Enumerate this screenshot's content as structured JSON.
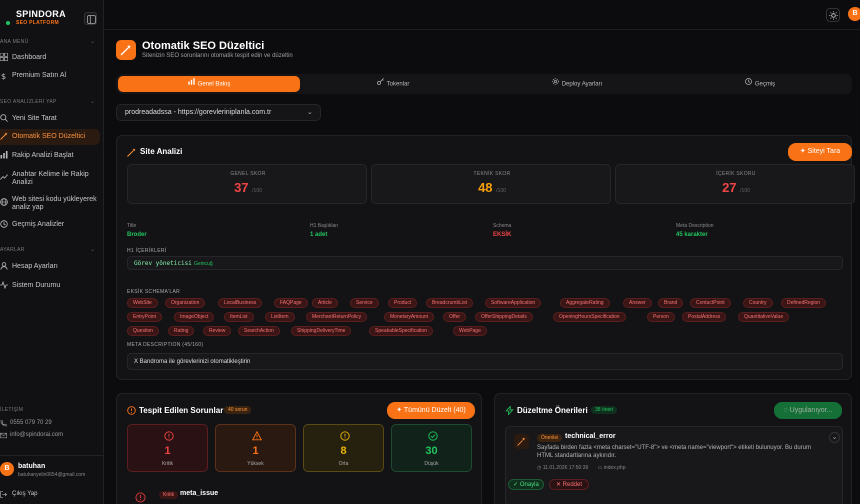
{
  "brand": {
    "name": "SPINDORA",
    "sub": "SEO PLATFORM"
  },
  "sidebar": {
    "section1": "ANA MENÜ",
    "items1": [
      "Dashboard",
      "Premium Satın Al"
    ],
    "section2": "SEO ANALİZLERİ YAP",
    "items2": [
      "Yeni Site Tarat",
      "Otomatik SEO Düzeltici",
      "Rakip Analizi Başlat",
      "Anahtar Kelime ile Rakip Analizi",
      "Web sitesi kodu yükleyerek analiz yap",
      "Geçmiş Analizler"
    ],
    "section3": "AYARLAR",
    "items3": [
      "Hesap Ayarları",
      "Sistem Durumu"
    ],
    "contact_title": "İLETİŞİM",
    "phone": "0555 079 70 29",
    "email": "info@spindorai.com",
    "user_name": "batuhan",
    "user_email": "batuhanyelin0654@gmail.com",
    "user_initial": "B",
    "logout": "Çıkış Yap"
  },
  "top": {
    "avatar_initial": "B"
  },
  "page": {
    "title": "Otomatik SEO Düzeltici",
    "subtitle": "Sitenizin SEO sorunlarını otomatik tespit edin ve düzeltin"
  },
  "tabs": [
    "Genel Bakış",
    "Tokenlar",
    "Deploy Ayarları",
    "Geçmiş"
  ],
  "site_select": {
    "value": "prodreadadssa - https://gorevleriniplanla.com.tr"
  },
  "analysis": {
    "title": "Site Analizi",
    "scan_button": "Siteyi Tara",
    "scores": [
      {
        "label": "GENEL SKOR",
        "value": "37",
        "max": "/100",
        "color": "#ef4444"
      },
      {
        "label": "TEKNİK SKOR",
        "value": "48",
        "max": "/100",
        "color": "#f59e0b"
      },
      {
        "label": "İÇERİK SKORU",
        "value": "27",
        "max": "/100",
        "color": "#ef4444"
      }
    ],
    "meta": [
      {
        "label": "Title",
        "value": "Broder",
        "color": "#22c55e"
      },
      {
        "label": "H1 Başlıkları",
        "value": "1 adet",
        "color": "#22c55e"
      },
      {
        "label": "Schema",
        "value": "EKSİK",
        "color": "#ef4444"
      },
      {
        "label": "Meta Description",
        "value": "45 karakter",
        "color": "#22c55e"
      }
    ],
    "h1_title": "H1 İÇERİKLERİ",
    "h1_value": "Görev yöneticisi",
    "h1_badge": "Geincuğ",
    "schema_title": "EKSİK SCHEMA'LAR",
    "schemas": [
      "WebSite",
      "Organization",
      "LocalBusiness",
      "FAQPage",
      "Article",
      "Service",
      "Product",
      "BreadcrumbList",
      "SoftwareApplication",
      "AggregateRating",
      "Answer",
      "Brand",
      "ContactPoint",
      "Country",
      "DefinedRegion",
      "EntryPoint",
      "ImageObject",
      "ItemList",
      "ListItem",
      "MerchantReturnPolicy",
      "MonetaryAmount",
      "Offer",
      "OfferShippingDetails",
      "OpeningHoursSpecification",
      "Person",
      "PostalAddress",
      "QuantitativeValue",
      "Question",
      "Rating",
      "Review",
      "SearchAction",
      "ShippingDeliveryTime",
      "SpeakableSpecification",
      "WebPage"
    ],
    "desc_title": "META DESCRIPTION (45/160)",
    "desc_value": "X Bandroma ile görevlerinizi otomatikleştirin"
  },
  "issues": {
    "title": "Tespit Edilen Sorunlar",
    "count_badge": "40 sorun",
    "fix_all": "Tümünü Düzelt (40)",
    "stats": [
      {
        "n": "1",
        "label": "Kritik",
        "color": "#ef4444",
        "bg": "#2a1214",
        "border": "#5c1e22"
      },
      {
        "n": "1",
        "label": "Yüksek",
        "color": "#f97316",
        "bg": "#2a1910",
        "border": "#5c331a"
      },
      {
        "n": "8",
        "label": "Orta",
        "color": "#eab308",
        "bg": "#26210f",
        "border": "#5a4a16"
      },
      {
        "n": "30",
        "label": "Düşük",
        "color": "#22c55e",
        "bg": "#10221a",
        "border": "#1d4a30"
      }
    ],
    "first_tag": "Kritik",
    "first_name": "meta_issue"
  },
  "fixes": {
    "title": "Düzeltme Önerileri",
    "count_badge": "38 öneri",
    "applying": "Uygulanıyor...",
    "item_tag": "Önerilei",
    "item_title": "technical_error",
    "item_desc": "Sayfada birden fazla <meta charset=\"UTF-8\"> ve <meta name=\"viewport\"> etiketi bulunuyor. Bu durum HTML standartlarına aykırıdır.",
    "item_date": "11.01.2026 17:50:39",
    "item_file": "index.php",
    "approve": "Onayla",
    "reject": "Reddet"
  }
}
